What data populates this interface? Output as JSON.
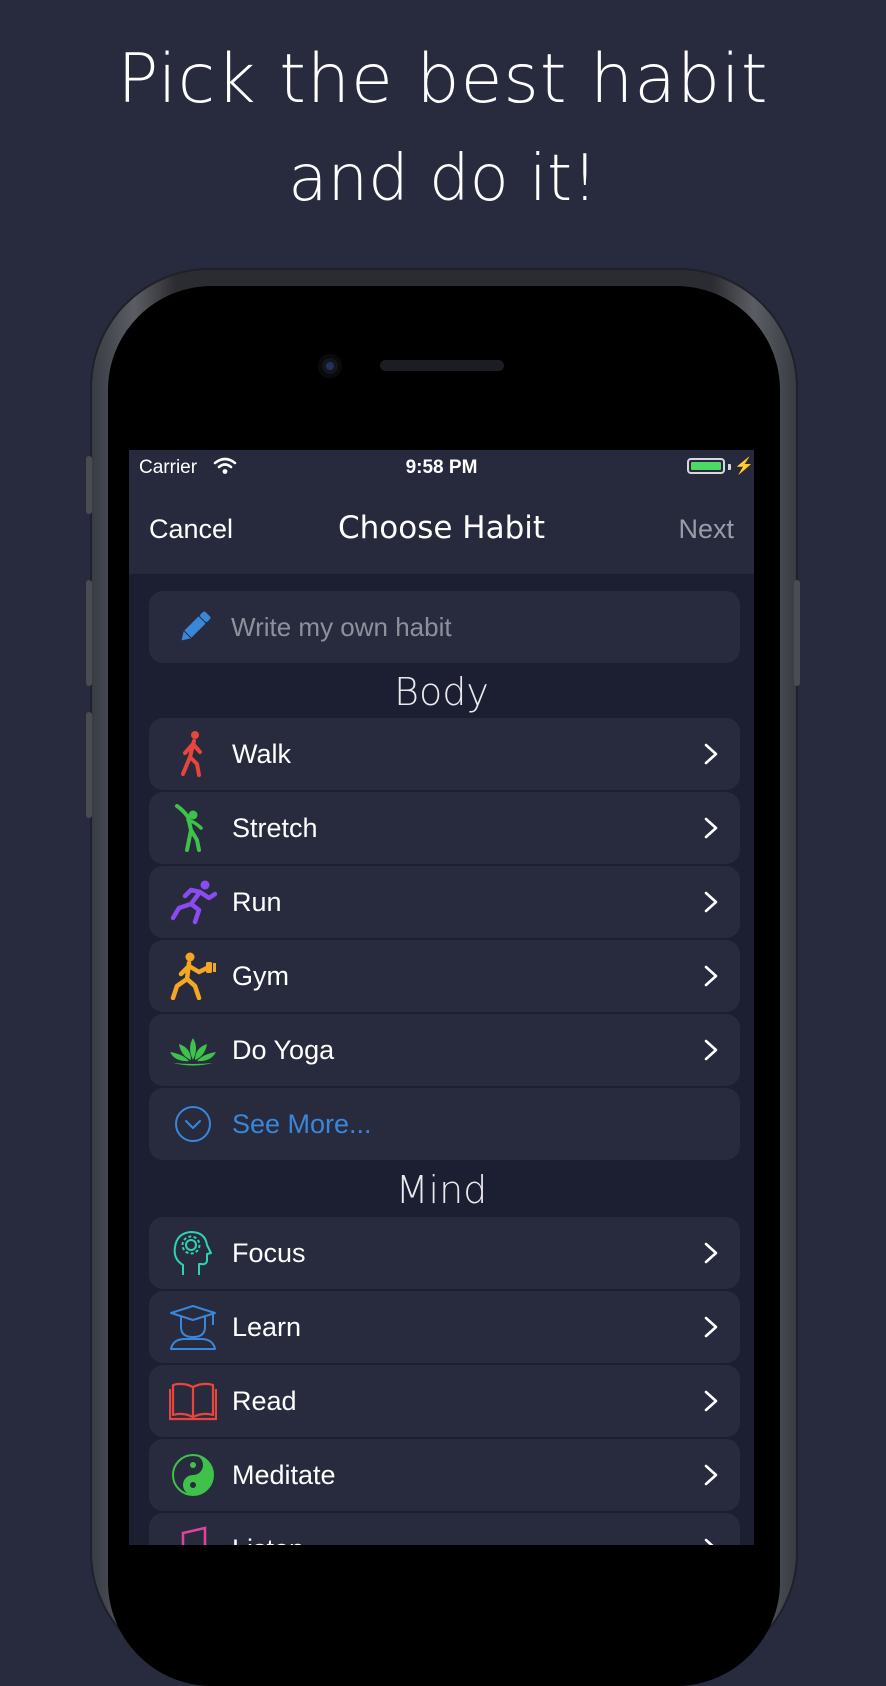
{
  "headline": {
    "line1": "Pick the best habit",
    "line2": "and do it!"
  },
  "status_bar": {
    "carrier": "Carrier",
    "time": "9:58 PM",
    "battery_level": 1.0
  },
  "nav": {
    "cancel": "Cancel",
    "title": "Choose Habit",
    "next": "Next"
  },
  "write_own": {
    "placeholder": "Write my own habit"
  },
  "sections": {
    "body": {
      "title": "Body",
      "items": [
        {
          "label": "Walk",
          "icon": "walk-icon",
          "color": "#e8453c"
        },
        {
          "label": "Stretch",
          "icon": "stretch-icon",
          "color": "#3ec24a"
        },
        {
          "label": "Run",
          "icon": "run-icon",
          "color": "#8a4cf0"
        },
        {
          "label": "Gym",
          "icon": "gym-icon",
          "color": "#f5a623"
        },
        {
          "label": "Do Yoga",
          "icon": "yoga-lotus-icon",
          "color": "#3ec24a"
        }
      ],
      "see_more": "See More..."
    },
    "mind": {
      "title": "Mind",
      "items": [
        {
          "label": "Focus",
          "icon": "focus-head-icon",
          "color": "#2ed3b0"
        },
        {
          "label": "Learn",
          "icon": "graduate-icon",
          "color": "#3a86d8"
        },
        {
          "label": "Read",
          "icon": "book-icon",
          "color": "#e8453c"
        },
        {
          "label": "Meditate",
          "icon": "yin-yang-icon",
          "color": "#3ec24a"
        },
        {
          "label": "Listen",
          "icon": "music-icon",
          "color": "#e0439c"
        }
      ]
    }
  },
  "colors": {
    "background": "#282b3e",
    "screen": "#1c1f31",
    "accent": "#3a86d8"
  }
}
